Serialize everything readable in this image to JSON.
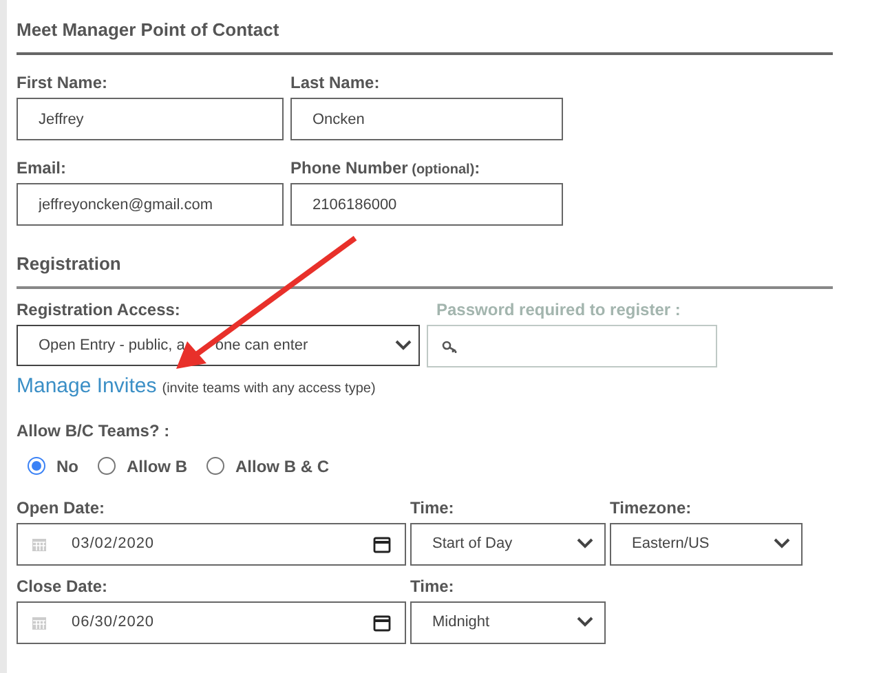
{
  "contact": {
    "title": "Meet Manager Point of Contact",
    "fields": [
      {
        "label": "First Name:",
        "value": "Jeffrey"
      },
      {
        "label": "Last Name:",
        "value": "Oncken"
      },
      {
        "label": "Email:",
        "value": "jeffreyoncken@gmail.com"
      },
      {
        "label": "Phone Number",
        "note": "(optional)",
        "suffix": ":",
        "value": "2106186000"
      }
    ]
  },
  "registration": {
    "title": "Registration",
    "access": {
      "label": "Registration Access:",
      "value_start": "Open Entry - public, a",
      "value_end": "one can enter"
    },
    "password": {
      "label": "Password required to register :",
      "disabled": true
    },
    "manage_invites": {
      "link": "Manage Invites",
      "note": "(invite teams with any access type)"
    },
    "teams": {
      "label": "Allow B/C Teams? :",
      "options": [
        {
          "label": "No",
          "selected": true
        },
        {
          "label": "Allow B",
          "selected": false
        },
        {
          "label": "Allow B & C",
          "selected": false
        }
      ]
    },
    "rows": [
      {
        "date_label": "Open Date:",
        "date": "03/02/2020",
        "time_label": "Time:",
        "time": "Start of Day",
        "tz_label": "Timezone:",
        "tz": "Eastern/US"
      },
      {
        "date_label": "Close Date:",
        "date": "06/30/2020",
        "time_label": "Time:",
        "time": "Midnight"
      }
    ]
  }
}
